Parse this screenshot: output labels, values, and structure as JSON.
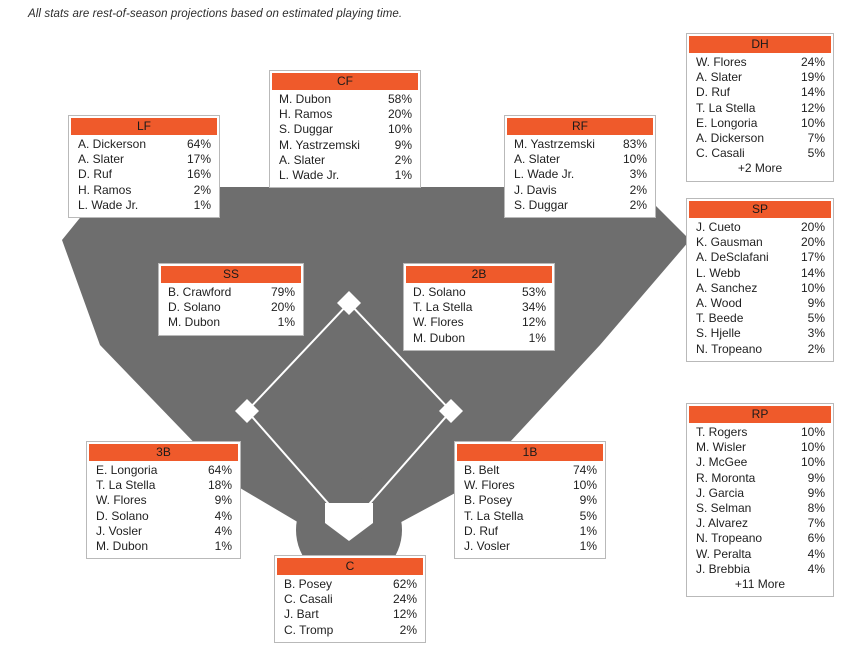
{
  "note": "All stats are rest-of-season projections based on estimated playing time.",
  "colors": {
    "header_orange": "#ef5a2b",
    "field_gray": "#6e6e6e",
    "base_white": "#ffffff",
    "box_border": "#b9b9b9"
  },
  "field": {
    "bases": [
      "first-base",
      "second-base",
      "third-base",
      "home-plate"
    ],
    "mound": "pitchers-mound"
  },
  "positions": [
    {
      "key": "lf",
      "label": "LF",
      "players": [
        {
          "name": "A. Dickerson",
          "pct": "64%"
        },
        {
          "name": "A. Slater",
          "pct": "17%"
        },
        {
          "name": "D. Ruf",
          "pct": "16%"
        },
        {
          "name": "H. Ramos",
          "pct": "2%"
        },
        {
          "name": "L. Wade Jr.",
          "pct": "1%"
        }
      ],
      "more": null
    },
    {
      "key": "cf",
      "label": "CF",
      "players": [
        {
          "name": "M. Dubon",
          "pct": "58%"
        },
        {
          "name": "H. Ramos",
          "pct": "20%"
        },
        {
          "name": "S. Duggar",
          "pct": "10%"
        },
        {
          "name": "M. Yastrzemski",
          "pct": "9%"
        },
        {
          "name": "A. Slater",
          "pct": "2%"
        },
        {
          "name": "L. Wade Jr.",
          "pct": "1%"
        }
      ],
      "more": null
    },
    {
      "key": "rf",
      "label": "RF",
      "players": [
        {
          "name": "M. Yastrzemski",
          "pct": "83%"
        },
        {
          "name": "A. Slater",
          "pct": "10%"
        },
        {
          "name": "L. Wade Jr.",
          "pct": "3%"
        },
        {
          "name": "J. Davis",
          "pct": "2%"
        },
        {
          "name": "S. Duggar",
          "pct": "2%"
        }
      ],
      "more": null
    },
    {
      "key": "ss",
      "label": "SS",
      "players": [
        {
          "name": "B. Crawford",
          "pct": "79%"
        },
        {
          "name": "D. Solano",
          "pct": "20%"
        },
        {
          "name": "M. Dubon",
          "pct": "1%"
        }
      ],
      "more": null
    },
    {
      "key": "2b",
      "label": "2B",
      "players": [
        {
          "name": "D. Solano",
          "pct": "53%"
        },
        {
          "name": "T. La Stella",
          "pct": "34%"
        },
        {
          "name": "W. Flores",
          "pct": "12%"
        },
        {
          "name": "M. Dubon",
          "pct": "1%"
        }
      ],
      "more": null
    },
    {
      "key": "3b",
      "label": "3B",
      "players": [
        {
          "name": "E. Longoria",
          "pct": "64%"
        },
        {
          "name": "T. La Stella",
          "pct": "18%"
        },
        {
          "name": "W. Flores",
          "pct": "9%"
        },
        {
          "name": "D. Solano",
          "pct": "4%"
        },
        {
          "name": "J. Vosler",
          "pct": "4%"
        },
        {
          "name": "M. Dubon",
          "pct": "1%"
        }
      ],
      "more": null
    },
    {
      "key": "1b",
      "label": "1B",
      "players": [
        {
          "name": "B. Belt",
          "pct": "74%"
        },
        {
          "name": "W. Flores",
          "pct": "10%"
        },
        {
          "name": "B. Posey",
          "pct": "9%"
        },
        {
          "name": "T. La Stella",
          "pct": "5%"
        },
        {
          "name": "D. Ruf",
          "pct": "1%"
        },
        {
          "name": "J. Vosler",
          "pct": "1%"
        }
      ],
      "more": null
    },
    {
      "key": "c",
      "label": "C",
      "players": [
        {
          "name": "B. Posey",
          "pct": "62%"
        },
        {
          "name": "C. Casali",
          "pct": "24%"
        },
        {
          "name": "J. Bart",
          "pct": "12%"
        },
        {
          "name": "C. Tromp",
          "pct": "2%"
        }
      ],
      "more": null
    },
    {
      "key": "dh",
      "label": "DH",
      "players": [
        {
          "name": "W. Flores",
          "pct": "24%"
        },
        {
          "name": "A. Slater",
          "pct": "19%"
        },
        {
          "name": "D. Ruf",
          "pct": "14%"
        },
        {
          "name": "T. La Stella",
          "pct": "12%"
        },
        {
          "name": "E. Longoria",
          "pct": "10%"
        },
        {
          "name": "A. Dickerson",
          "pct": "7%"
        },
        {
          "name": "C. Casali",
          "pct": "5%"
        }
      ],
      "more": "+2 More"
    },
    {
      "key": "sp",
      "label": "SP",
      "players": [
        {
          "name": "J. Cueto",
          "pct": "20%"
        },
        {
          "name": "K. Gausman",
          "pct": "20%"
        },
        {
          "name": "A. DeSclafani",
          "pct": "17%"
        },
        {
          "name": "L. Webb",
          "pct": "14%"
        },
        {
          "name": "A. Sanchez",
          "pct": "10%"
        },
        {
          "name": "A. Wood",
          "pct": "9%"
        },
        {
          "name": "T. Beede",
          "pct": "5%"
        },
        {
          "name": "S. Hjelle",
          "pct": "3%"
        },
        {
          "name": "N. Tropeano",
          "pct": "2%"
        }
      ],
      "more": null
    },
    {
      "key": "rp",
      "label": "RP",
      "players": [
        {
          "name": "T. Rogers",
          "pct": "10%"
        },
        {
          "name": "M. Wisler",
          "pct": "10%"
        },
        {
          "name": "J. McGee",
          "pct": "10%"
        },
        {
          "name": "R. Moronta",
          "pct": "9%"
        },
        {
          "name": "J. Garcia",
          "pct": "9%"
        },
        {
          "name": "S. Selman",
          "pct": "8%"
        },
        {
          "name": "J. Alvarez",
          "pct": "7%"
        },
        {
          "name": "N. Tropeano",
          "pct": "6%"
        },
        {
          "name": "W. Peralta",
          "pct": "4%"
        },
        {
          "name": "J. Brebbia",
          "pct": "4%"
        }
      ],
      "more": "+11 More"
    }
  ]
}
